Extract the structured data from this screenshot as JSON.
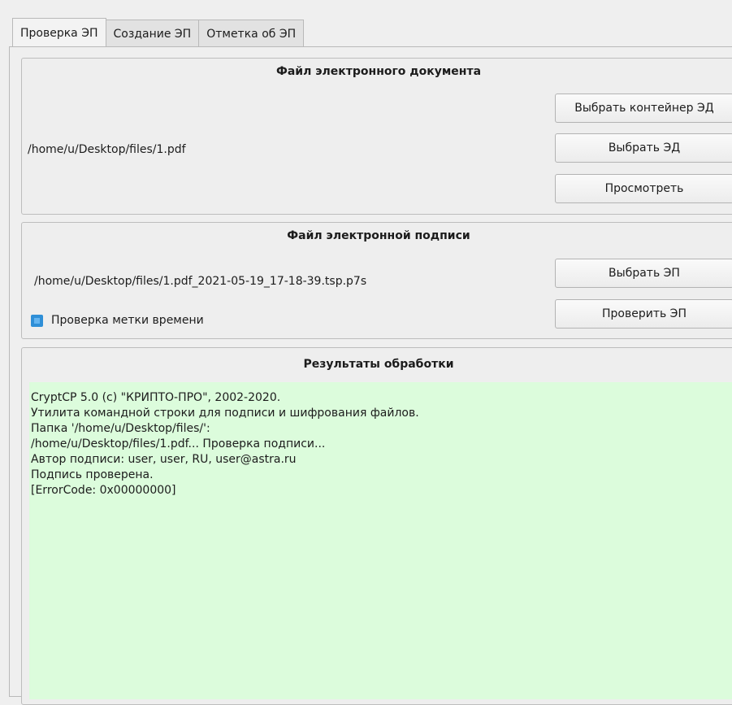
{
  "tabs": [
    "Проверка ЭП",
    "Создание ЭП",
    "Отметка об ЭП"
  ],
  "document_group": {
    "title": "Файл электронного документа",
    "path": "/home/u/Desktop/files/1.pdf",
    "buttons": {
      "select_container": "Выбрать контейнер ЭД",
      "select_document": "Выбрать ЭД",
      "view": "Просмотреть"
    }
  },
  "signature_group": {
    "title": "Файл электронной подписи",
    "path": "/home/u/Desktop/files/1.pdf_2021-05-19_17-18-39.tsp.p7s",
    "checkbox_label": "Проверка метки времени",
    "checkbox_checked": true,
    "buttons": {
      "select_signature": "Выбрать ЭП",
      "verify_signature": "Проверить ЭП"
    }
  },
  "results_group": {
    "title": "Результаты обработки",
    "lines": [
      "CryptCP 5.0 (c) \"КРИПТО-ПРО\", 2002-2020.",
      "Утилита командной строки для подписи и шифрования файлов.",
      "Папка '/home/u/Desktop/files/':",
      "/home/u/Desktop/files/1.pdf... Проверка подписи...",
      "Автор подписи: user, user, RU, user@astra.ru",
      "Подпись проверена.",
      "[ErrorCode: 0x00000000]"
    ]
  },
  "colors": {
    "result_background": "#dcfcdc",
    "checkbox_accent": "#2f8fd7"
  }
}
